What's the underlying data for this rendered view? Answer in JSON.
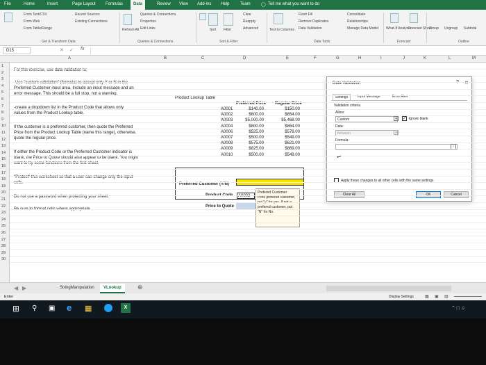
{
  "ribbon": {
    "tabs": [
      "File",
      "Home",
      "Insert",
      "Page Layout",
      "Formulas",
      "Data",
      "Review",
      "View",
      "Add-ins",
      "Help",
      "Team"
    ],
    "tell_me": "Tell me what you want to do",
    "groups": {
      "get_transform": "Get & Transform Data",
      "queries": "Queries & Connections",
      "sort_filter": "Sort & Filter",
      "data_tools": "Data Tools",
      "forecast": "Forecast",
      "outline": "Outline"
    },
    "buttons": {
      "from_text": "From Text/CSV",
      "from_web": "From Web",
      "from_table": "From Table/Range",
      "recent_sources": "Recent Sources",
      "existing_connections": "Existing Connections",
      "refresh_all": "Refresh All",
      "queries_connections": "Queries & Connections",
      "properties": "Properties",
      "edit_links": "Edit Links",
      "sort": "Sort",
      "filter": "Filter",
      "clear": "Clear",
      "reapply": "Reapply",
      "advanced": "Advanced",
      "text_to_columns": "Text to Columns",
      "flash_fill": "Flash Fill",
      "remove_duplicates": "Remove Duplicates",
      "data_validation": "Data Validation",
      "consolidate": "Consolidate",
      "relationships": "Relationships",
      "manage_data_model": "Manage Data Model",
      "what_if": "What-If Analysis",
      "forecast_sheet": "Forecast Sheet",
      "group": "Group",
      "ungroup": "Ungroup",
      "subtotal": "Subtotal"
    }
  },
  "formula_bar": {
    "name_box": "D15",
    "content": ""
  },
  "columns": [
    "A",
    "B",
    "C",
    "D",
    "E",
    "F",
    "G",
    "H",
    "I",
    "J",
    "K",
    "L",
    "M"
  ],
  "rows": [
    "1",
    "2",
    "3",
    "4",
    "5",
    "6",
    "7",
    "8",
    "9",
    "10",
    "11",
    "12",
    "13",
    "14",
    "15",
    "16",
    "17",
    "18",
    "19",
    "20",
    "21",
    "22",
    "23",
    "24",
    "25",
    "26",
    "27",
    "28",
    "29",
    "30"
  ],
  "instructions": {
    "intro": "For this exercise, use data validation to:",
    "line1a": "-Use \"custom validation\" (formula) to accept only Y or N in the",
    "line1b": "Preferred Customer input area. Include an input message and an",
    "line1c": "error message. This should be a full stop, not a warning.",
    "line2a": "-create a dropdown list in the Product Code that allows only",
    "line2b": "values from the Product Lookup table.",
    "line3a": "If the customer is a preferred customer, then quote the Preferred",
    "line3b": "Price from the Product Lookup Table (name this range), otherwise,",
    "line3c": "quote the regular price.",
    "line4a": "If either the Product Code or the Preferred Customer indicator is",
    "line4b": "blank, the Price to Quote should also appear to be blank. You might",
    "line4c": "want to try some functions from the first sheet.",
    "line5a": "\"Protect\" this worksheet so that a user can change only the input",
    "line5b": "cells.",
    "line6": "Do not use a password when protecting your sheet.",
    "line7": "Be sure to format cells where appropriate."
  },
  "lookup": {
    "title": "Product Lookup Table",
    "headers": [
      "Preferred Price",
      "Regular Price"
    ],
    "rows": [
      [
        "A0001",
        "$140.00",
        "$150.00"
      ],
      [
        "A0002",
        "$600.00",
        "$654.00"
      ],
      [
        "A0003",
        "$5,000.00",
        "$5,468.00"
      ],
      [
        "A0004",
        "$800.00",
        "$864.00"
      ],
      [
        "A0006",
        "$525.00",
        "$578.00"
      ],
      [
        "A0007",
        "$500.00",
        "$549.00"
      ],
      [
        "A0008",
        "$575.00",
        "$621.00"
      ],
      [
        "A0009",
        "$825.00",
        "$869.00"
      ],
      [
        "A0010",
        "$500.00",
        "$549.00"
      ]
    ]
  },
  "inputs": {
    "preferred_label": "Preferred Customer (Y/N)",
    "product_label": "Product Code",
    "product_value": "A0002",
    "price_label": "Price to Quote",
    "tooltip_title": "Prefered Customer",
    "tooltip_body": "If the prefered customer, put \"y\" for yes. If not a prefered customer, put \"N\" for No."
  },
  "dialog": {
    "title": "Data Validation",
    "tabs": [
      "Settings",
      "Input Message",
      "Error Alert"
    ],
    "section": "Validation criteria",
    "allow_label": "Allow:",
    "allow_value": "Custom",
    "ignore_blank": "Ignore blank",
    "data_label": "Data:",
    "data_value": "between",
    "formula_label": "Formula:",
    "apply_all": "Apply these changes to all other cells with the same settings",
    "clear_all": "Clear All",
    "ok": "OK",
    "cancel": "Cancel"
  },
  "sheet_tabs": [
    "StringManipulation",
    "VLookup"
  ],
  "status": {
    "mode": "Enter",
    "display_settings": "Display Settings"
  }
}
